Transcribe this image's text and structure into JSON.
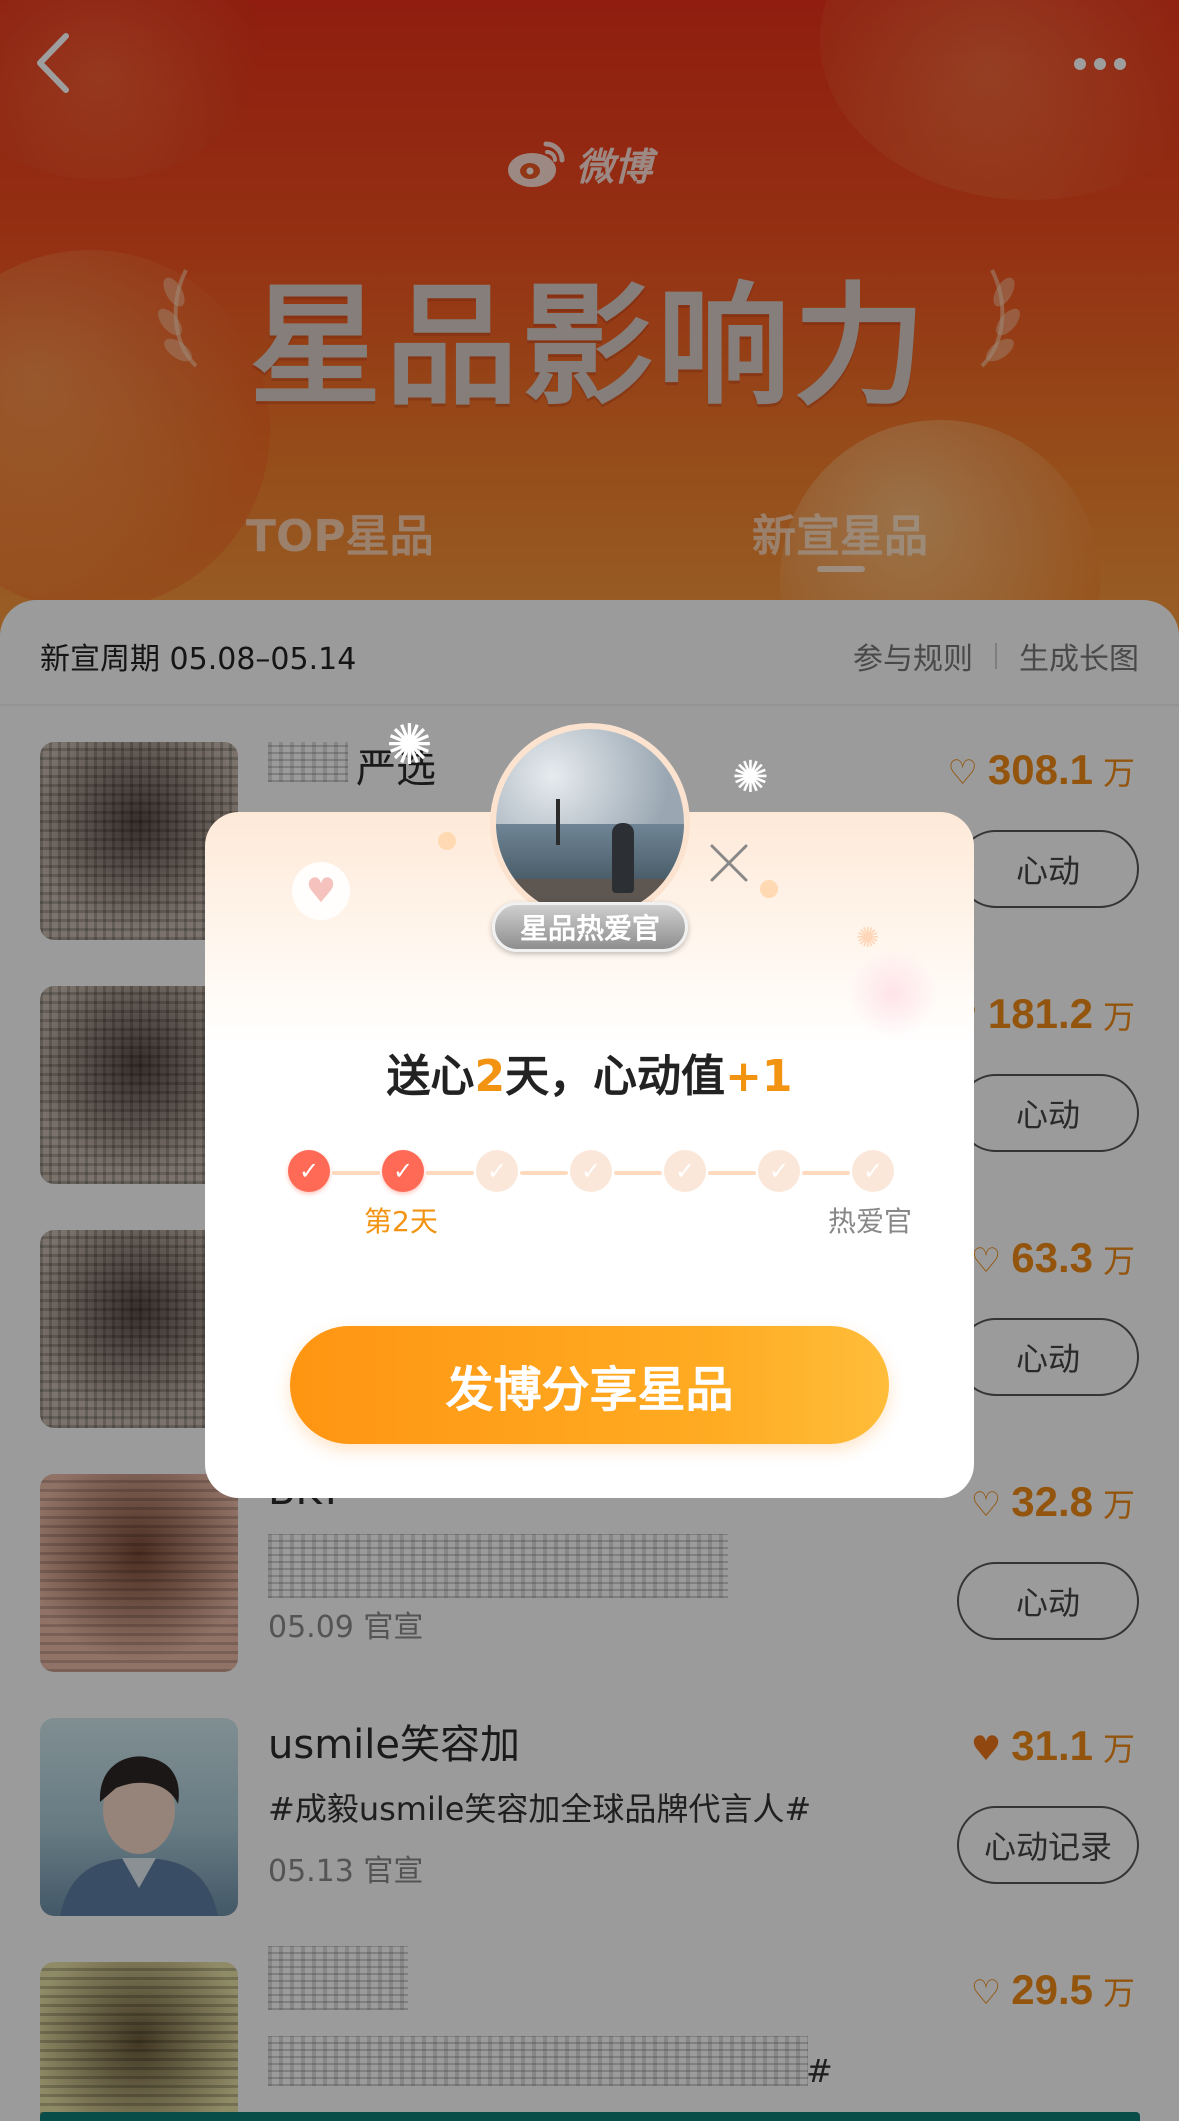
{
  "header": {
    "logo_text": "微博",
    "hero_title": "星品影响力",
    "tabs": [
      {
        "label": "TOP星品",
        "active": false
      },
      {
        "label": "新宣星品",
        "active": true
      }
    ]
  },
  "period": {
    "label": "新宣周期 05.08–05.14",
    "rules_link": "参与规则",
    "long_image_link": "生成长图"
  },
  "list": [
    {
      "brand": "严选",
      "tagline": "",
      "date": "",
      "score": "308.1",
      "unit": "万",
      "button": "心动",
      "loved": false
    },
    {
      "brand": "",
      "tagline": "",
      "date": "",
      "score": "181.2",
      "unit": "万",
      "button": "心动",
      "loved": false
    },
    {
      "brand": "",
      "tagline": "",
      "date": "",
      "score": "63.3",
      "unit": "万",
      "button": "心动",
      "loved": false
    },
    {
      "brand": "BKT",
      "tagline": "",
      "date": "05.09 官宣",
      "score": "32.8",
      "unit": "万",
      "button": "心动",
      "loved": false
    },
    {
      "brand": "usmile笑容加",
      "tagline": "#成毅usmile笑容加全球品牌代言人#",
      "date": "05.13 官宣",
      "score": "31.1",
      "unit": "万",
      "button": "心动记录",
      "loved": true
    },
    {
      "brand": "",
      "tagline": "#",
      "date": "",
      "score": "29.5",
      "unit": "万",
      "button": "",
      "loved": false
    }
  ],
  "modal": {
    "badge": "星品热爱官",
    "title_prefix": "送心",
    "title_days": "2",
    "title_mid": "天，心动值",
    "title_plus": "+1",
    "progress": {
      "total_days": 7,
      "completed_days": 2,
      "current_label": "第2天",
      "end_label": "热爱官"
    },
    "share_button": "发博分享星品"
  },
  "colors": {
    "accent": "#f39312",
    "header_red": "#e8301a",
    "heart_done": "#ff6a56"
  }
}
